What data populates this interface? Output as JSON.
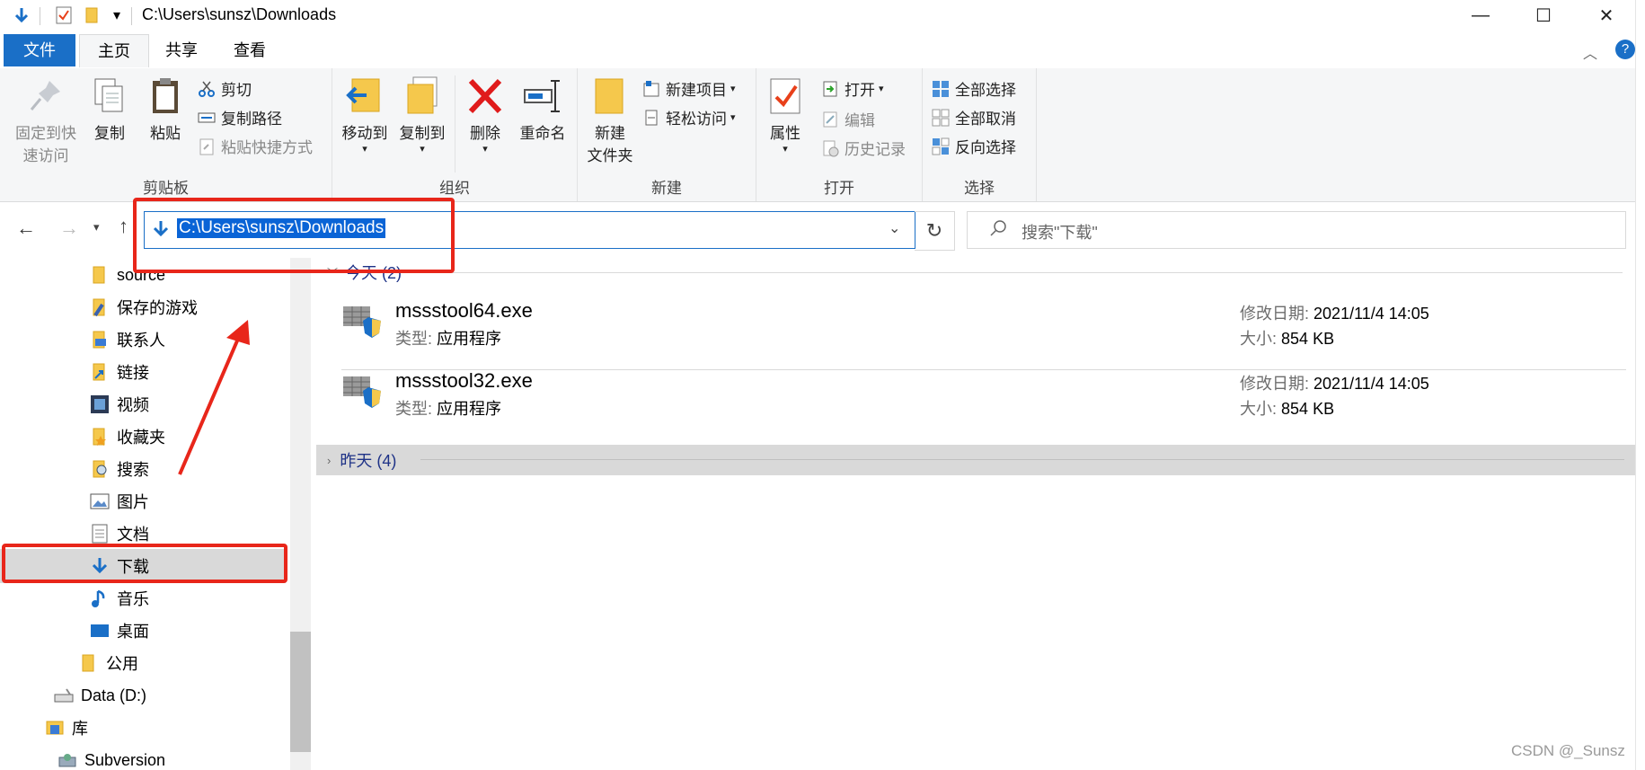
{
  "window": {
    "title": "C:\\Users\\sunsz\\Downloads",
    "quick_access_dropdown": "▾",
    "minimize": "—",
    "maximize": "☐",
    "close": "✕"
  },
  "ribbon_tabs": [
    "文件",
    "主页",
    "共享",
    "查看"
  ],
  "ribbon": {
    "clipboard": {
      "label": "剪贴板",
      "pin": "固定到快速访问",
      "pin_line1": "固定到快",
      "pin_line2": "速访问",
      "copy": "复制",
      "paste": "粘贴",
      "cut": "剪切",
      "copy_path": "复制路径",
      "paste_shortcut": "粘贴快捷方式"
    },
    "organize": {
      "label": "组织",
      "move_to": "移动到",
      "copy_to": "复制到",
      "delete": "删除",
      "rename": "重命名"
    },
    "new": {
      "label": "新建",
      "new_folder_line1": "新建",
      "new_folder_line2": "文件夹",
      "new_item": "新建项目",
      "easy_access": "轻松访问"
    },
    "open": {
      "label": "打开",
      "properties": "属性",
      "open": "打开",
      "edit": "编辑",
      "history": "历史记录"
    },
    "select": {
      "label": "选择",
      "select_all": "全部选择",
      "select_none": "全部取消",
      "invert": "反向选择"
    }
  },
  "address": {
    "path": "C:\\Users\\sunsz\\Downloads",
    "search_placeholder": "搜索\"下载\""
  },
  "nav": [
    {
      "label": "source",
      "icon": "folder-icon"
    },
    {
      "label": "保存的游戏",
      "icon": "saved-games-icon"
    },
    {
      "label": "联系人",
      "icon": "contacts-icon"
    },
    {
      "label": "链接",
      "icon": "links-icon"
    },
    {
      "label": "视频",
      "icon": "videos-icon"
    },
    {
      "label": "收藏夹",
      "icon": "favorites-icon"
    },
    {
      "label": "搜索",
      "icon": "searches-icon"
    },
    {
      "label": "图片",
      "icon": "pictures-icon"
    },
    {
      "label": "文档",
      "icon": "documents-icon"
    },
    {
      "label": "下载",
      "icon": "downloads-icon",
      "selected": true
    },
    {
      "label": "音乐",
      "icon": "music-icon"
    },
    {
      "label": "桌面",
      "icon": "desktop-icon"
    },
    {
      "label": "公用",
      "icon": "folder-icon"
    },
    {
      "label": "Data (D:)",
      "icon": "drive-icon"
    },
    {
      "label": "库",
      "icon": "libraries-icon"
    },
    {
      "label": "Subversion",
      "icon": "subversion-icon"
    }
  ],
  "content": {
    "today_header": "今天 (2)",
    "yesterday_header": "昨天 (4)",
    "files": [
      {
        "name": "mssstool64.exe",
        "type_label": "类型:",
        "type": "应用程序",
        "date_label": "修改日期:",
        "date": "2021/11/4 14:05",
        "size_label": "大小:",
        "size": "854 KB"
      },
      {
        "name": "mssstool32.exe",
        "type_label": "类型:",
        "type": "应用程序",
        "date_label": "修改日期:",
        "date": "2021/11/4 14:05",
        "size_label": "大小:",
        "size": "854 KB"
      }
    ]
  },
  "watermark": "CSDN @_Sunsz",
  "colors": {
    "accent": "#1a6fc7",
    "annotation": "#e8261a",
    "ribbon_bg": "#f5f6f7"
  }
}
